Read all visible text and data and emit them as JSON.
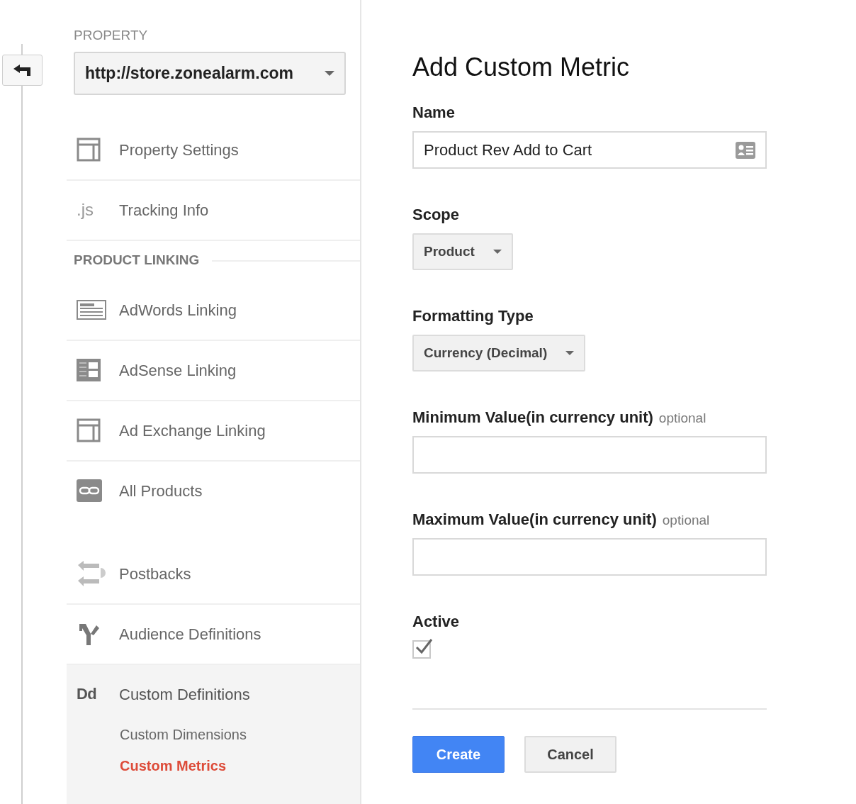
{
  "property": {
    "label": "PROPERTY",
    "value": "http://store.zonealarm.com"
  },
  "sections": [
    {
      "items": [
        {
          "label": "Property Settings",
          "selected": false
        },
        {
          "label": "Tracking Info",
          "icon_text": ".js",
          "selected": false
        }
      ]
    },
    {
      "title": "PRODUCT LINKING",
      "items": [
        {
          "label": "AdWords Linking",
          "selected": false
        },
        {
          "label": "AdSense Linking",
          "selected": false
        },
        {
          "label": "Ad Exchange Linking",
          "selected": false
        },
        {
          "label": "All Products",
          "selected": false
        }
      ]
    },
    {
      "items": [
        {
          "label": "Postbacks",
          "selected": false
        },
        {
          "label": "Audience Definitions",
          "selected": false
        },
        {
          "label": "Custom Definitions",
          "icon_text": "Dd",
          "selected": true,
          "children": [
            {
              "label": "Custom Dimensions",
              "selected": false
            },
            {
              "label": "Custom Metrics",
              "selected": true
            }
          ]
        }
      ]
    }
  ],
  "form": {
    "title": "Add Custom Metric",
    "fields": [
      {
        "kind": "text",
        "label": "Name",
        "value": "Product Rev Add to Cart"
      },
      {
        "kind": "select",
        "label": "Scope",
        "value": "Product"
      },
      {
        "kind": "select",
        "label": "Formatting Type",
        "value": "Currency (Decimal)"
      },
      {
        "kind": "text",
        "label": "Minimum Value(in currency unit)",
        "hint": "optional"
      },
      {
        "kind": "text",
        "label": "Maximum Value(in currency unit)",
        "hint": "optional"
      },
      {
        "kind": "checkbox",
        "label": "Active",
        "checked": true
      }
    ],
    "buttons": [
      {
        "label": "Create",
        "primary": true
      },
      {
        "label": "Cancel",
        "primary": false
      }
    ]
  }
}
